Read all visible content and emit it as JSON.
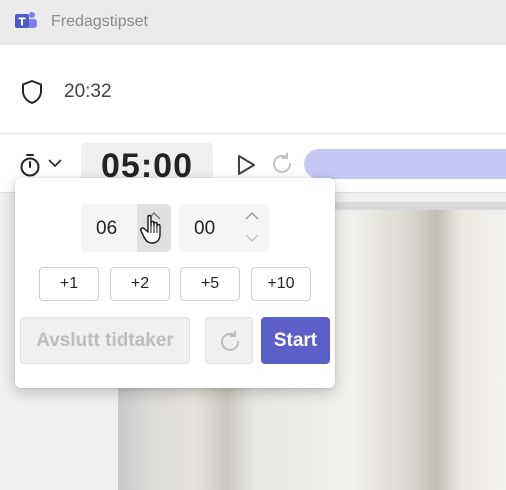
{
  "app": {
    "title": "Fredagstipset",
    "brand_color": "#5b5fc7",
    "logo_icon": "teams-icon"
  },
  "meeting": {
    "time": "20:32",
    "security_icon": "shield-icon"
  },
  "toolbar": {
    "timer_icon": "timer-icon",
    "time_display": "05:00",
    "play_icon": "play-icon",
    "reset_icon": "reset-icon",
    "progress_color": "#c5c7f5"
  },
  "timer_popover": {
    "hours": "06",
    "minutes": "00",
    "quick_add": [
      "+1",
      "+2",
      "+5",
      "+10"
    ],
    "end_label": "Avslutt tidtaker",
    "start_label": "Start"
  }
}
